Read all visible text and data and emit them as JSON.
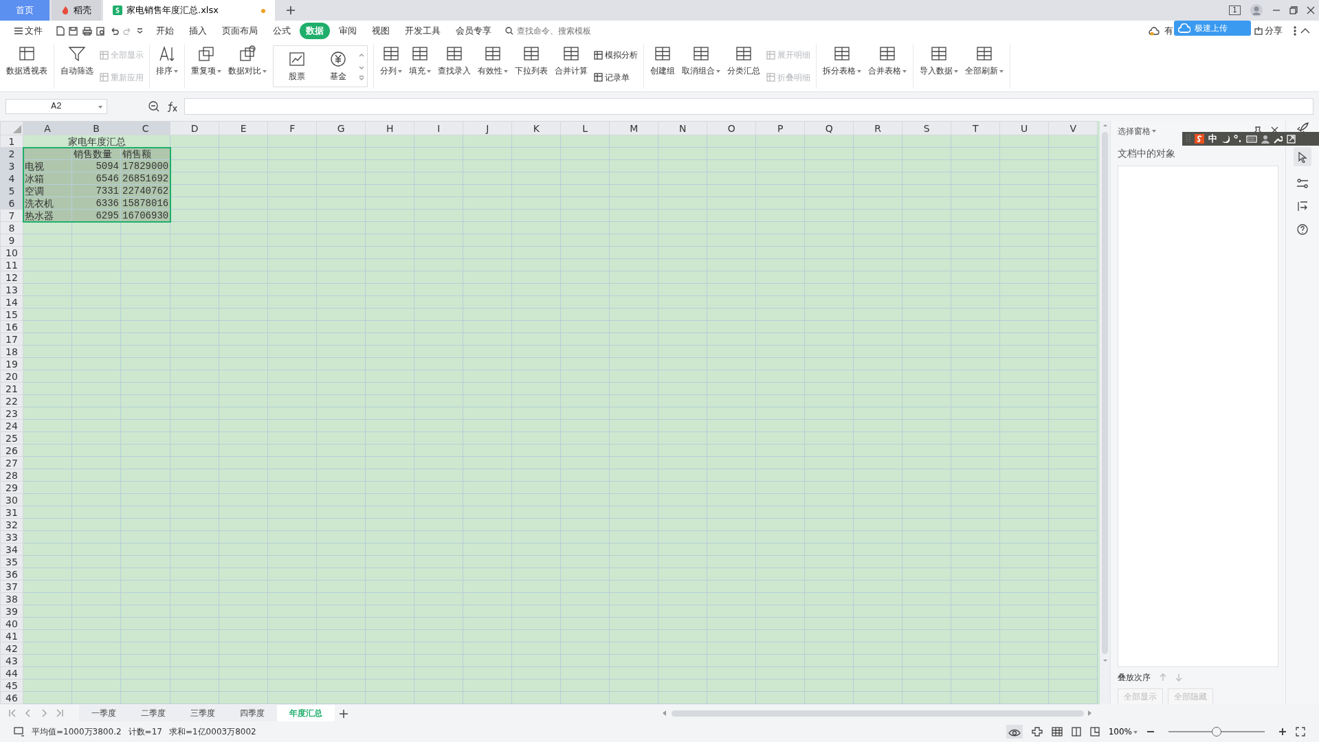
{
  "tabs": [
    {
      "label": "首页",
      "selected": false,
      "kind": "home"
    },
    {
      "label": "稻壳",
      "selected": false,
      "kind": "docer"
    },
    {
      "label": "家电销售年度汇总.xlsx",
      "selected": true,
      "kind": "sheet",
      "modified": true
    }
  ],
  "window_badge": "1",
  "menu": {
    "file": "文件",
    "items": [
      {
        "label": "开始",
        "selected": false
      },
      {
        "label": "插入",
        "selected": false
      },
      {
        "label": "页面布局",
        "selected": false
      },
      {
        "label": "公式",
        "selected": false
      },
      {
        "label": "数据",
        "selected": true
      },
      {
        "label": "审阅",
        "selected": false
      },
      {
        "label": "视图",
        "selected": false
      },
      {
        "label": "开发工具",
        "selected": false
      },
      {
        "label": "会员专享",
        "selected": false
      }
    ],
    "search": {
      "placeholder": "查找命令、搜索模板"
    }
  },
  "cloud": {
    "status": "有",
    "upload": "极速上传",
    "share": "分享"
  },
  "ribbon": [
    [
      {
        "kind": "large",
        "label": "数据透视表",
        "dropdown": false
      }
    ],
    [
      {
        "kind": "large",
        "label": "自动筛选",
        "dropdown": false
      },
      {
        "kind": "stack",
        "items": [
          {
            "label": "全部显示",
            "disabled": true
          },
          {
            "label": "重新应用",
            "disabled": true
          }
        ]
      }
    ],
    [
      {
        "kind": "large",
        "label": "排序",
        "dropdown": true
      }
    ],
    [
      {
        "kind": "large",
        "label": "重复项",
        "dropdown": true
      },
      {
        "kind": "large",
        "label": "数据对比",
        "dropdown": true
      },
      {
        "kind": "gallery",
        "items": [
          {
            "label": "股票"
          },
          {
            "label": "基金"
          }
        ]
      }
    ],
    [
      {
        "kind": "large",
        "label": "分列",
        "dropdown": true
      },
      {
        "kind": "large",
        "label": "填充",
        "dropdown": true
      },
      {
        "kind": "large",
        "label": "查找录入",
        "dropdown": false
      },
      {
        "kind": "large",
        "label": "有效性",
        "dropdown": true
      },
      {
        "kind": "large",
        "label": "下拉列表",
        "dropdown": false
      },
      {
        "kind": "large",
        "label": "合并计算",
        "dropdown": false
      },
      {
        "kind": "stack",
        "items": [
          {
            "label": "模拟分析",
            "disabled": false
          },
          {
            "label": "记录单",
            "disabled": false
          }
        ]
      }
    ],
    [
      {
        "kind": "large",
        "label": "创建组",
        "dropdown": false
      },
      {
        "kind": "large",
        "label": "取消组合",
        "dropdown": true
      },
      {
        "kind": "large",
        "label": "分类汇总",
        "dropdown": false
      },
      {
        "kind": "stack",
        "items": [
          {
            "label": "展开明细",
            "disabled": true
          },
          {
            "label": "折叠明细",
            "disabled": true
          }
        ]
      }
    ],
    [
      {
        "kind": "large",
        "label": "拆分表格",
        "dropdown": true
      },
      {
        "kind": "large",
        "label": "合并表格",
        "dropdown": true
      }
    ],
    [
      {
        "kind": "large",
        "label": "导入数据",
        "dropdown": true
      },
      {
        "kind": "large",
        "label": "全部刷新",
        "dropdown": true
      }
    ]
  ],
  "name_box": "A2",
  "columns": [
    "A",
    "B",
    "C",
    "D",
    "E",
    "F",
    "G",
    "H",
    "I",
    "J",
    "K",
    "L",
    "M",
    "N",
    "O",
    "P",
    "Q",
    "R",
    "S",
    "T",
    "U",
    "V"
  ],
  "rows": [
    "1",
    "2",
    "3",
    "4",
    "5",
    "6",
    "7",
    "8",
    "9",
    "10",
    "11",
    "12",
    "13",
    "14",
    "15",
    "16",
    "17",
    "18",
    "19",
    "20",
    "21",
    "22",
    "23",
    "24",
    "25",
    "26",
    "27",
    "28",
    "29",
    "30",
    "31",
    "32",
    "33",
    "34",
    "35",
    "36",
    "37",
    "38",
    "39",
    "40",
    "41",
    "42",
    "43",
    "44",
    "45",
    "46"
  ],
  "table": {
    "title": "家电年度汇总",
    "headers": [
      "销售数量",
      "销售额"
    ],
    "rows": [
      {
        "item": "电视",
        "quantity": "5094",
        "sales": "17829000"
      },
      {
        "item": "冰箱",
        "quantity": "6546",
        "sales": "26851692"
      },
      {
        "item": "空调",
        "quantity": "7331",
        "sales": "22740762"
      },
      {
        "item": "洗衣机",
        "quantity": "6336",
        "sales": "15878016"
      },
      {
        "item": "热水器",
        "quantity": "6295",
        "sales": "16706930"
      }
    ]
  },
  "sheets": [
    {
      "label": "一季度",
      "selected": false
    },
    {
      "label": "二季度",
      "selected": false
    },
    {
      "label": "三季度",
      "selected": false
    },
    {
      "label": "四季度",
      "selected": false
    },
    {
      "label": "年度汇总",
      "selected": true
    }
  ],
  "status": [
    "平均值=1000万3800.2",
    "计数=17",
    "求和=1亿0003万8002"
  ],
  "zoom": {
    "label": "100%",
    "level": 0.5
  },
  "pane": {
    "title": "选择窗格",
    "heading": "文档中的对象",
    "order_label": "叠放次序",
    "buttons": [
      {
        "label": "全部显示",
        "disabled": true
      },
      {
        "label": "全部隐藏",
        "disabled": true
      }
    ]
  },
  "ime": {
    "mode": "中"
  }
}
